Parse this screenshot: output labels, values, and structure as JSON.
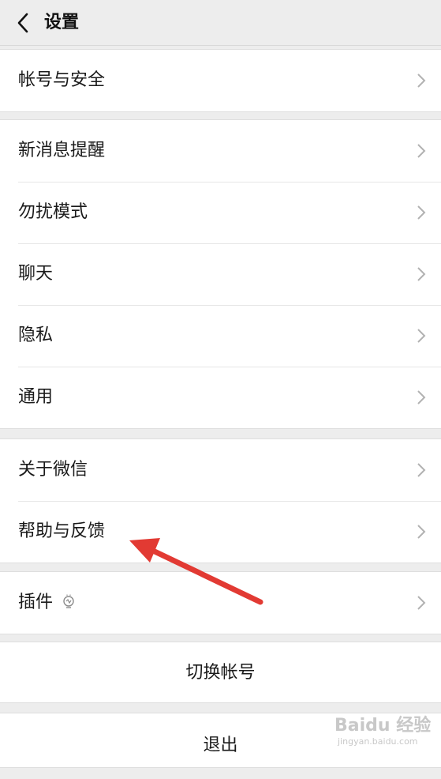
{
  "header": {
    "title": "设置"
  },
  "groups": [
    {
      "items": [
        {
          "label": "帐号与安全"
        }
      ]
    },
    {
      "items": [
        {
          "label": "新消息提醒"
        },
        {
          "label": "勿扰模式"
        },
        {
          "label": "聊天"
        },
        {
          "label": "隐私"
        },
        {
          "label": "通用"
        }
      ]
    },
    {
      "items": [
        {
          "label": "关于微信"
        },
        {
          "label": "帮助与反馈"
        }
      ]
    },
    {
      "items": [
        {
          "label": "插件"
        }
      ]
    }
  ],
  "actions": {
    "switch_account": "切换帐号",
    "logout": "退出"
  },
  "watermark": {
    "main": "Baidu 经验",
    "sub": "jingyan.baidu.com"
  },
  "colors": {
    "annotation_arrow": "#e23a33",
    "background": "#ededed"
  },
  "icons": {
    "back": "back-arrow-icon",
    "chevron": "chevron-right-icon",
    "plugin": "plugin-bulb-icon"
  }
}
